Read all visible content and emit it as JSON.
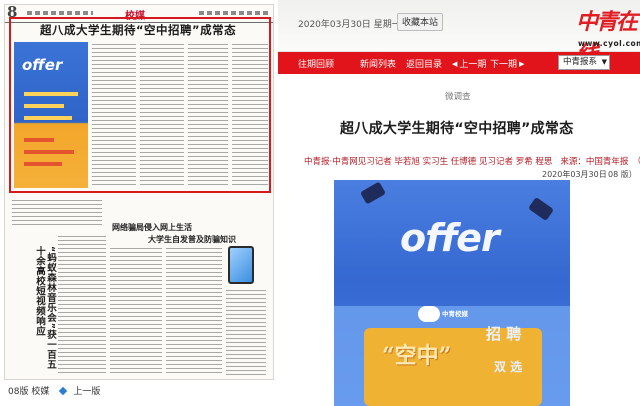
{
  "newspaper": {
    "page_no": "8",
    "section": "校媒",
    "main_headline": "超八成大学生期待“空中招聘”成常态",
    "poster_word": "offer",
    "second_headline_1": "网络骗局侵入网上生活",
    "second_headline_2": "大学生自发普及防骗知识",
    "vertical_headline": "“蚂蚁森林音乐会”获一百五十余高校短视频响应",
    "footer": {
      "page_label": "08版 校媒",
      "prev_label": "上一版"
    }
  },
  "header": {
    "date": "2020年03月30日",
    "weekday": "星期一",
    "bookmark_button": "收藏本站",
    "logo": "中青在线",
    "logo_url": "www.cyol.com"
  },
  "nav": {
    "items": [
      "往期回顾",
      "新闻列表",
      "返回目录",
      "上一期",
      "下一期"
    ],
    "select_value": "中青报系"
  },
  "article": {
    "kicker": "微调查",
    "title": "超八成大学生期待“空中招聘”成常态",
    "byline": "中青报·中青网见习记者 毕若旭 实习生 任博德 见习记者 罗希 程思",
    "source": "来源：中国青年报",
    "scroll_mark": "（",
    "date": "2020年03月30日",
    "page": "08 版）",
    "poster": {
      "word": "offer",
      "brand": "中青校媒",
      "main_text": "“空中”",
      "text_zhaopin": "招 聘",
      "text_shuangxuan": "双 选"
    }
  }
}
